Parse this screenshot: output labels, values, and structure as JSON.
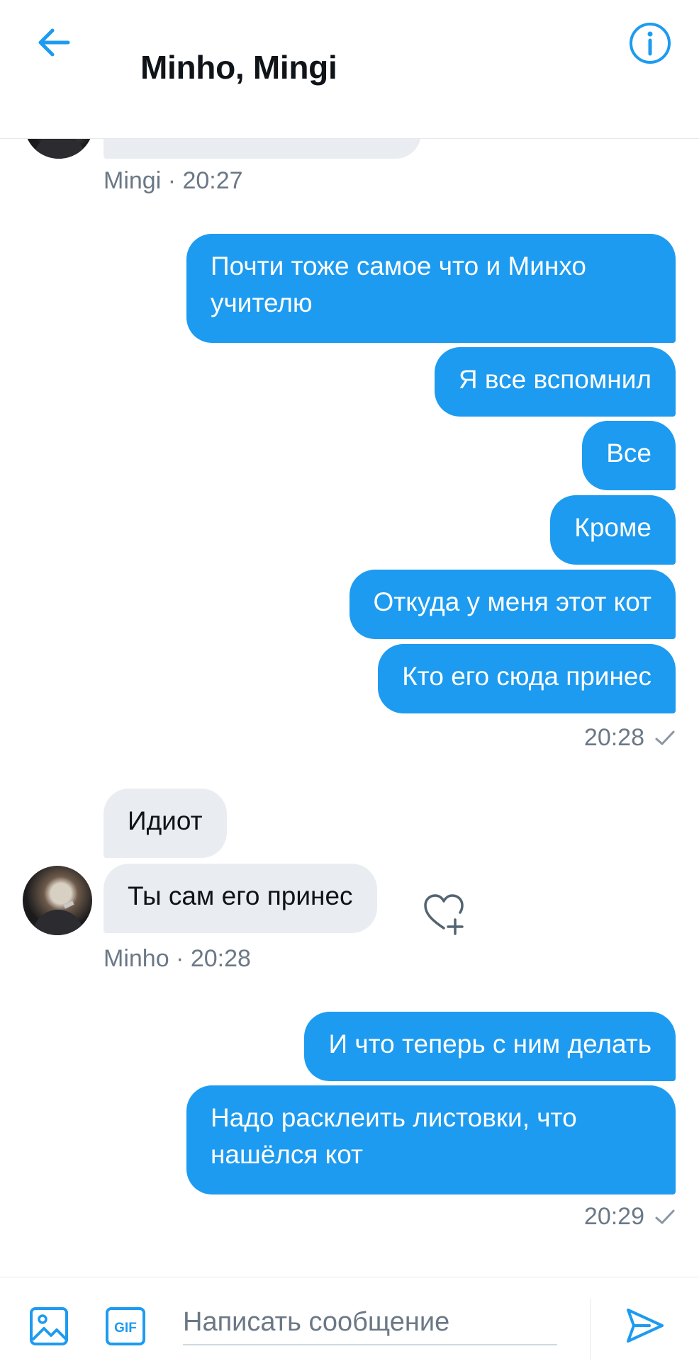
{
  "header": {
    "title": "Minho, Mingi",
    "back_icon": "arrow-left-icon",
    "info_icon": "info-icon"
  },
  "messages": {
    "top_meta": "Mingi · 20:27",
    "out_group_1": [
      "Почти тоже самое что и Минхо учителю",
      "Я все вспомнил",
      "Все",
      "Кроме",
      "Откуда у меня этот кот",
      "Кто его сюда принес"
    ],
    "out_group_1_time": "20:28",
    "in_group_1": [
      "Идиот",
      "Ты сам его принес"
    ],
    "in_group_1_meta": "Minho · 20:28",
    "out_group_2": [
      "И что теперь с ним делать",
      "Надо расклеить листовки, что нашёлся кот"
    ],
    "out_group_2_time": "20:29"
  },
  "composer": {
    "placeholder": "Написать сообщение",
    "gif_label": "GIF",
    "media_icon": "image-icon",
    "send_icon": "send-icon"
  },
  "colors": {
    "accent": "#1d9bf0",
    "incoming_bubble": "#e9ecf0",
    "meta_text": "#6b7886"
  }
}
